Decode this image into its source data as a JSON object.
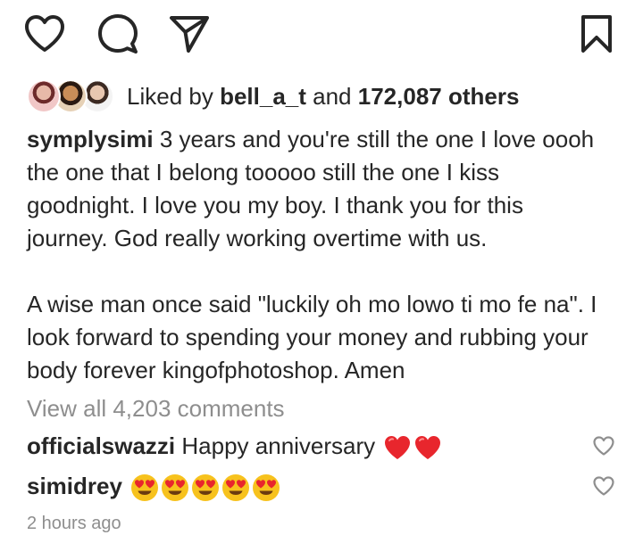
{
  "actions": {
    "icons": [
      "heart-outline",
      "comment-bubble",
      "paper-plane",
      "bookmark-outline"
    ]
  },
  "likes": {
    "prefix": "Liked by",
    "user": "bell_a_t",
    "connector": "and",
    "count": "172,087 others"
  },
  "caption": {
    "username": "symplysimi",
    "paragraph1": "3 years and you're still the one I love oooh the  one that I belong tooooo still the one I kiss goodnight. I love you my boy. I thank you for this journey. God really working overtime with us.",
    "paragraph2": "A wise man once said \"luckily oh mo lowo ti mo fe na\". I look forward to spending your money and rubbing your body forever kingofphotoshop. Amen"
  },
  "view_comments": "View all 4,203 comments",
  "comments": [
    {
      "username": "officialswazzi",
      "text": "Happy anniversary",
      "emoji": [
        "red-heart",
        "red-heart"
      ]
    },
    {
      "username": "simidrey",
      "text": "",
      "emoji": [
        "heart-eyes",
        "heart-eyes",
        "heart-eyes",
        "heart-eyes",
        "heart-eyes"
      ]
    }
  ],
  "timestamp": "2 hours ago",
  "colors": {
    "text": "#262626",
    "muted": "#8e8e8e",
    "heart": "#e8262d",
    "emoji_face": "#f7c21d"
  }
}
